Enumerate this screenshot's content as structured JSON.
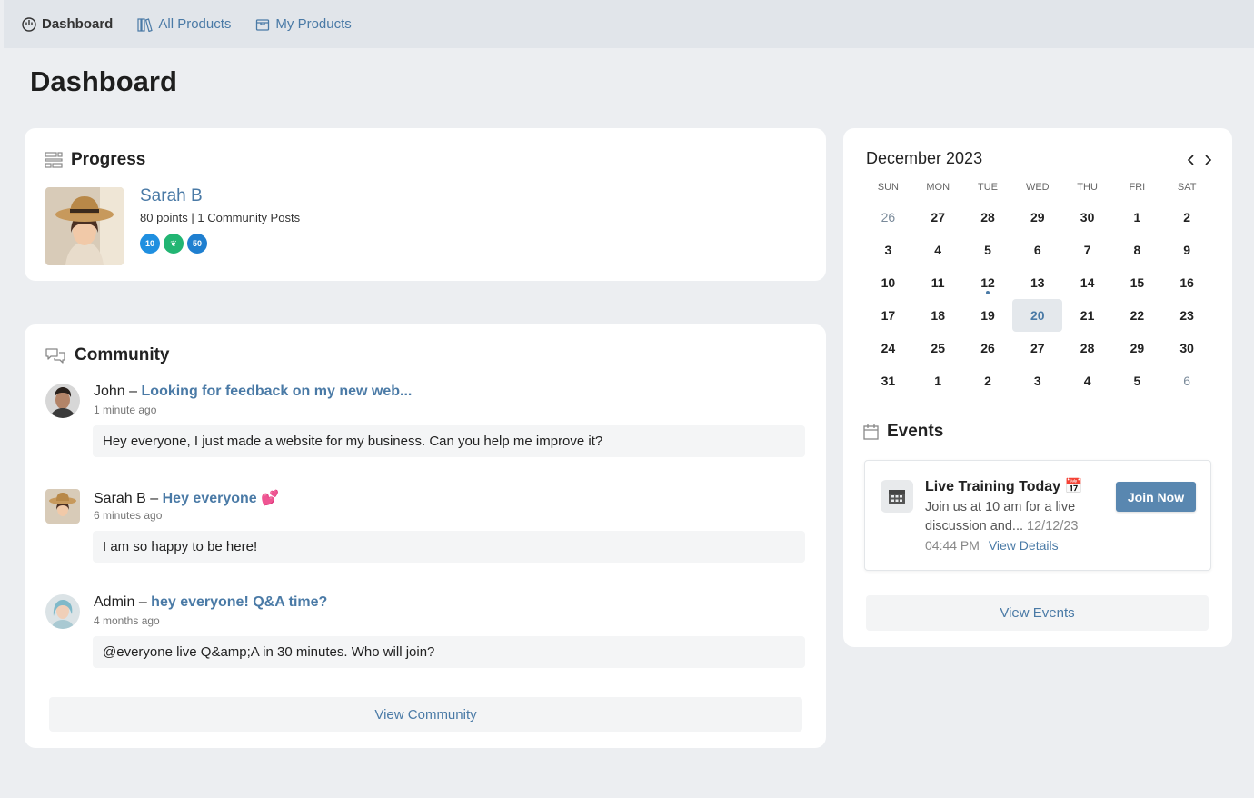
{
  "nav": {
    "items": [
      {
        "label": "Dashboard",
        "icon": "dashboard-icon",
        "active": true
      },
      {
        "label": "All Products",
        "icon": "library-icon",
        "active": false
      },
      {
        "label": "My Products",
        "icon": "box-icon",
        "active": false
      }
    ]
  },
  "page": {
    "title": "Dashboard"
  },
  "progress": {
    "heading": "Progress",
    "user_name": "Sarah B",
    "stats": "80 points | 1 Community Posts",
    "badges": [
      {
        "label": "10",
        "color": "#1f8fe0"
      },
      {
        "label": "❦",
        "color": "#22b573"
      },
      {
        "label": "50",
        "color": "#1f7fd0"
      }
    ]
  },
  "community": {
    "heading": "Community",
    "posts": [
      {
        "author": "John",
        "separator": "–",
        "title": "Looking for feedback on my new web...",
        "time": "1 minute ago",
        "body": "Hey everyone, I just made a website for my business. Can you help me improve it?"
      },
      {
        "author": "Sarah B",
        "separator": "–",
        "title": "Hey everyone 💕",
        "time": "6 minutes ago",
        "body": "I am so happy to be here!"
      },
      {
        "author": "Admin",
        "separator": "–",
        "title": "hey everyone! Q&A time?",
        "time": "4 months ago",
        "body": "@everyone live Q&amp;A in 30 minutes. Who will join?"
      }
    ],
    "view_all_label": "View Community"
  },
  "calendar": {
    "month_title": "December 2023",
    "weekdays": [
      "SUN",
      "MON",
      "TUE",
      "WED",
      "THU",
      "FRI",
      "SAT"
    ],
    "days": [
      {
        "d": "26",
        "muted": true
      },
      {
        "d": "27"
      },
      {
        "d": "28"
      },
      {
        "d": "29"
      },
      {
        "d": "30"
      },
      {
        "d": "1"
      },
      {
        "d": "2"
      },
      {
        "d": "3"
      },
      {
        "d": "4"
      },
      {
        "d": "5"
      },
      {
        "d": "6"
      },
      {
        "d": "7"
      },
      {
        "d": "8"
      },
      {
        "d": "9"
      },
      {
        "d": "10"
      },
      {
        "d": "11"
      },
      {
        "d": "12",
        "event": true
      },
      {
        "d": "13"
      },
      {
        "d": "14"
      },
      {
        "d": "15"
      },
      {
        "d": "16"
      },
      {
        "d": "17"
      },
      {
        "d": "18"
      },
      {
        "d": "19"
      },
      {
        "d": "20",
        "today": true
      },
      {
        "d": "21"
      },
      {
        "d": "22"
      },
      {
        "d": "23"
      },
      {
        "d": "24"
      },
      {
        "d": "25"
      },
      {
        "d": "26"
      },
      {
        "d": "27"
      },
      {
        "d": "28"
      },
      {
        "d": "29"
      },
      {
        "d": "30"
      },
      {
        "d": "31"
      },
      {
        "d": "1"
      },
      {
        "d": "2"
      },
      {
        "d": "3"
      },
      {
        "d": "4"
      },
      {
        "d": "5"
      },
      {
        "d": "6",
        "muted": true
      }
    ]
  },
  "events": {
    "heading": "Events",
    "item": {
      "title": "Live Training Today 📅",
      "description": "Join us at 10 am for a live discussion and...",
      "date": "12/12/23",
      "time": "04:44 PM",
      "details_label": "View Details",
      "join_label": "Join Now"
    },
    "view_all_label": "View Events"
  },
  "colors": {
    "accent": "#4a7aa6",
    "button": "#5987b0",
    "background": "#eceef1"
  }
}
